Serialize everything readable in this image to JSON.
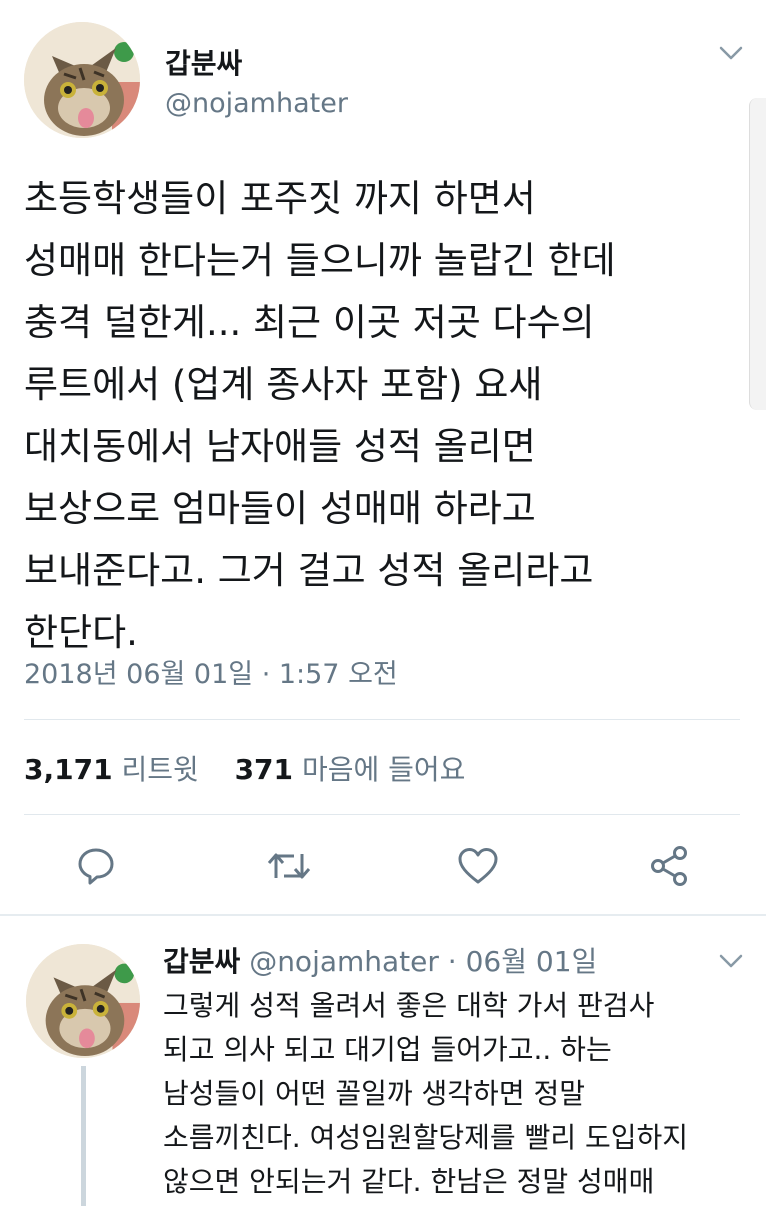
{
  "tweet": {
    "display_name": "갑분싸",
    "handle": "@nojamhater",
    "text_lines": [
      "초등학생들이 포주짓 까지 하면서",
      "성매매 한다는거 들으니까 놀랍긴 한데",
      "충격 덜한게... 최근 이곳 저곳 다수의",
      "루트에서 (업계 종사자 포함) 요새",
      "대치동에서 남자애들 성적 올리면",
      "보상으로 엄마들이 성매매 하라고",
      "보내준다고. 그거 걸고 성적 올리라고",
      "한단다."
    ],
    "timestamp": "2018년 06월 01일 · 1:57 오전",
    "retweet_count": "3,171",
    "retweet_label": "리트윗",
    "like_count": "371",
    "like_label": "마음에 들어요"
  },
  "actions": {
    "reply_icon": "reply-icon",
    "retweet_icon": "retweet-icon",
    "like_icon": "heart-icon",
    "share_icon": "share-icon"
  },
  "reply": {
    "display_name": "갑분싸",
    "meta": "@nojamhater · 06월 01일",
    "text_lines": [
      "그렇게 성적 올려서 좋은 대학 가서 판검사",
      "되고 의사 되고 대기업 들어가고.. 하는",
      "남성들이 어떤 꼴일까 생각하면 정말",
      "소름끼친다. 여성임원할당제를 빨리 도입하지",
      "않으면 안되는거 같다. 한남은 정말 성매매"
    ]
  },
  "colors": {
    "text": "#14171a",
    "secondary": "#657786",
    "icon": "#657786",
    "divider": "#e1e8ed"
  }
}
